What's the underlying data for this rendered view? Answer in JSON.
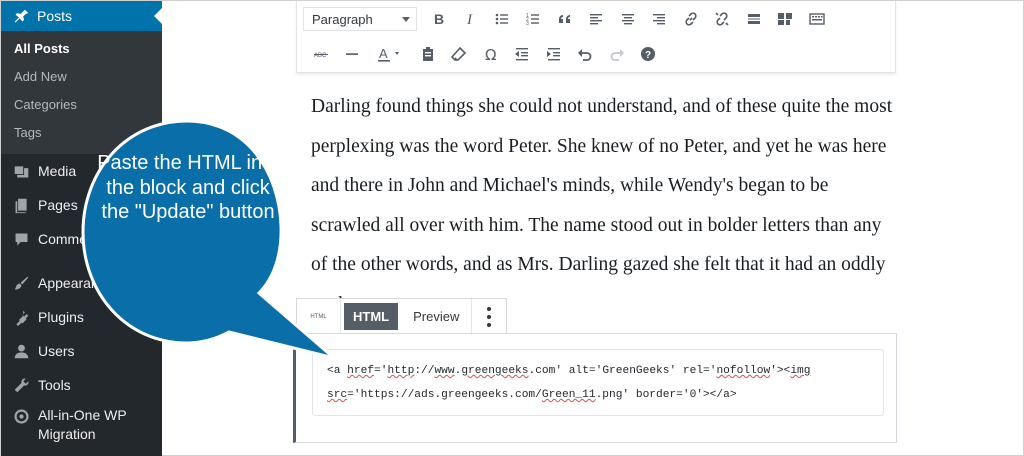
{
  "sidebar": {
    "posts_label": "Posts",
    "sub_items": [
      "All Posts",
      "Add New",
      "Categories",
      "Tags"
    ],
    "items": [
      "Media",
      "Pages",
      "Comments",
      "Appearance",
      "Plugins",
      "Users",
      "Tools"
    ],
    "migration_line1": "All-in-One WP",
    "migration_line2": "Migration"
  },
  "toolbar": {
    "format_value": "Paragraph"
  },
  "paragraph": {
    "text": "Darling found things she could not understand, and of these quite the most perplexing was the word Peter. She knew of no Peter, and yet he was here and there in John and Michael's minds, while Wendy's began to be scrawled all over with him. The name stood out in bolder letters than any of the other words, and as Mrs. Darling gazed she felt that it had an oddly cocky appearance."
  },
  "html_block": {
    "mini_label": "HTML",
    "html_tab": "HTML",
    "preview_tab": "Preview",
    "code_line1_parts": [
      "<a ",
      "href",
      "='",
      "http",
      "://",
      "www",
      ".",
      "greengeeks",
      ".com' alt='GreenGeeks' rel='",
      "nofollow",
      "'><",
      "img"
    ],
    "code_line2_parts": [
      "src",
      "='https://ads.greengeeks.com/",
      "Green_11",
      ".png' border='0'></a>"
    ]
  },
  "callout": {
    "text": "Paste the HTML into the block and click the \"Update\" button",
    "color": "#0a6ea8"
  },
  "colors": {
    "sidebar_bg": "#23282d",
    "active_menu": "#0073aa"
  }
}
